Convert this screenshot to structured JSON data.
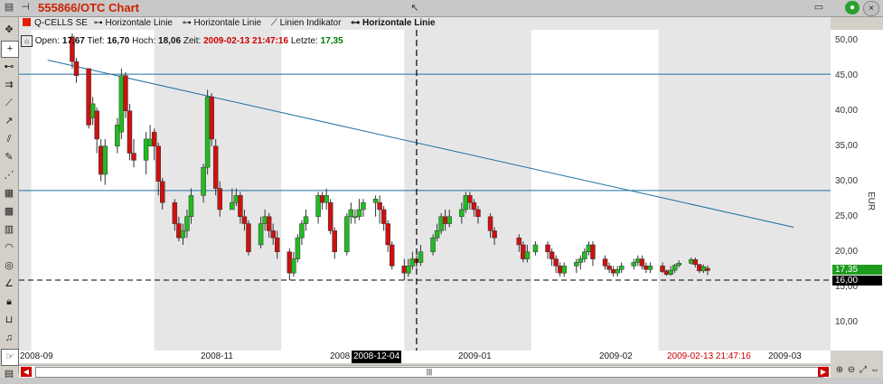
{
  "window": {
    "title": "555866/OTC Chart",
    "close_glyph": "×"
  },
  "legend": {
    "instrument": "Q-CELLS SE",
    "items": [
      "Horizontale Linie",
      "Horizontale Linie",
      "Linien Indikator",
      "Horizontale Linie"
    ]
  },
  "info": {
    "open_label": "Open:",
    "open": "17,67",
    "low_label": "Tief:",
    "low": "16,70",
    "high_label": "Hoch:",
    "high": "18,06",
    "time_label": "Zeit:",
    "time": "2009-02-13 21:47:16",
    "last_label": "Letzte:",
    "last": "17,35"
  },
  "axis": {
    "currency": "EUR",
    "ticks": [
      "50,00",
      "45,00",
      "40,00",
      "35,00",
      "30,00",
      "25,00",
      "20,00",
      "15,00",
      "10,00"
    ],
    "last_tag": "17,35",
    "cursor_tag": "16,00"
  },
  "x_labels": {
    "sep": "2008-09",
    "nov": "2008-11",
    "dec_partial": "2008",
    "cursor": "2008-12-04",
    "jan": "2009-01",
    "feb": "2009-02",
    "current": "2009-02-13 21:47:16",
    "mar": "2009-03"
  },
  "scroll": {
    "thumb": "|||"
  },
  "colors": {
    "up": "#22bb22",
    "down": "#cc1111",
    "line": "#1f6fa0",
    "title": "#cc2200"
  },
  "chart_data": {
    "type": "candlestick",
    "ylim": [
      6,
      51.5
    ],
    "horizontal_lines": [
      45.2,
      28.7,
      16.0
    ],
    "trendline": {
      "from": [
        "2008-09-05",
        47.2
      ],
      "to": [
        "2009-03-06",
        23.5
      ]
    },
    "cursor_date": "2008-12-04",
    "candles": [
      [
        "2008-09-11",
        50.5,
        47,
        51,
        46
      ],
      [
        "2008-09-12",
        47,
        45,
        47.5,
        44
      ],
      [
        "2008-09-15",
        46,
        38,
        46,
        37.5
      ],
      [
        "2008-09-16",
        39,
        41,
        42,
        38
      ],
      [
        "2008-09-17",
        40,
        36,
        40.5,
        34
      ],
      [
        "2008-09-18",
        35,
        31,
        36,
        30
      ],
      [
        "2008-09-19",
        31,
        35,
        36,
        29.5
      ],
      [
        "2008-09-22",
        35,
        38,
        39,
        34
      ],
      [
        "2008-09-23",
        37,
        45,
        46,
        36
      ],
      [
        "2008-09-24",
        45,
        40,
        45.5,
        39
      ],
      [
        "2008-09-25",
        40,
        34,
        41,
        33
      ],
      [
        "2008-09-26",
        34,
        33,
        36,
        32
      ],
      [
        "2008-09-29",
        33,
        36,
        37,
        31
      ],
      [
        "2008-09-30",
        35,
        36,
        38,
        35
      ],
      [
        "2008-10-01",
        37,
        35,
        37.5,
        33
      ],
      [
        "2008-10-02",
        35,
        30,
        35.5,
        28
      ],
      [
        "2008-10-03",
        30,
        27,
        30.5,
        26
      ],
      [
        "2008-10-06",
        27,
        24,
        27.5,
        23
      ],
      [
        "2008-10-07",
        24,
        22,
        25,
        21.5
      ],
      [
        "2008-10-08",
        22,
        23,
        24,
        21
      ],
      [
        "2008-10-09",
        23,
        25,
        26,
        22
      ],
      [
        "2008-10-10",
        25,
        28,
        29,
        24
      ],
      [
        "2008-10-13",
        28,
        32,
        32.5,
        27
      ],
      [
        "2008-10-14",
        32,
        42,
        43,
        31
      ],
      [
        "2008-10-15",
        42,
        36,
        42.5,
        35
      ],
      [
        "2008-10-16",
        35,
        29,
        36,
        28
      ],
      [
        "2008-10-17",
        29,
        26,
        30,
        25
      ],
      [
        "2008-10-20",
        26,
        27,
        29,
        26
      ],
      [
        "2008-10-21",
        27,
        28,
        29,
        26.5
      ],
      [
        "2008-10-22",
        28,
        25,
        28.5,
        24
      ],
      [
        "2008-10-23",
        25,
        24,
        26,
        23
      ],
      [
        "2008-10-24",
        24,
        20,
        24.5,
        19.5
      ],
      [
        "2008-10-27",
        21,
        24,
        25,
        20.5
      ],
      [
        "2008-10-28",
        24,
        25,
        26,
        23
      ],
      [
        "2008-10-29",
        25,
        23,
        25.5,
        22
      ],
      [
        "2008-10-30",
        23,
        22,
        24,
        21
      ],
      [
        "2008-10-31",
        22,
        20,
        23,
        19
      ],
      [
        "2008-11-03",
        20,
        17,
        20.5,
        16
      ],
      [
        "2008-11-04",
        17,
        19,
        20,
        16.5
      ],
      [
        "2008-11-05",
        19,
        22,
        22.5,
        18.5
      ],
      [
        "2008-11-06",
        22,
        24,
        24.5,
        21
      ],
      [
        "2008-11-07",
        24,
        25,
        26,
        23
      ],
      [
        "2008-11-10",
        25,
        28,
        28.5,
        24
      ],
      [
        "2008-11-11",
        28,
        27,
        28.5,
        26
      ],
      [
        "2008-11-12",
        27,
        28,
        29,
        26
      ],
      [
        "2008-11-13",
        27,
        23,
        27.5,
        22.5
      ],
      [
        "2008-11-14",
        23,
        20,
        23.5,
        19
      ],
      [
        "2008-11-17",
        20,
        25,
        25.5,
        19.5
      ],
      [
        "2008-11-18",
        25,
        26,
        27,
        24
      ],
      [
        "2008-11-19",
        25,
        25,
        26,
        24
      ],
      [
        "2008-11-20",
        25,
        26,
        27.5,
        24.5
      ],
      [
        "2008-11-21",
        26,
        27,
        27.5,
        25
      ],
      [
        "2008-11-24",
        27,
        27.5,
        28,
        25
      ],
      [
        "2008-11-25",
        27,
        26,
        28,
        24
      ],
      [
        "2008-11-26",
        26,
        24,
        26.5,
        23
      ],
      [
        "2008-11-27",
        24,
        21,
        24.5,
        20
      ],
      [
        "2008-11-28",
        21,
        18,
        21.5,
        17.5
      ],
      [
        "2008-12-01",
        18,
        17,
        19,
        16
      ],
      [
        "2008-12-02",
        17,
        18,
        19,
        16.5
      ],
      [
        "2008-12-03",
        18,
        19,
        20,
        17.5
      ],
      [
        "2008-12-04",
        19,
        18.5,
        19.5,
        17.8
      ],
      [
        "2008-12-05",
        18.5,
        20,
        21,
        18
      ],
      [
        "2008-12-08",
        20,
        22,
        22.5,
        19.5
      ],
      [
        "2008-12-09",
        22,
        23,
        24,
        21.5
      ],
      [
        "2008-12-10",
        23,
        25,
        25.5,
        22.5
      ],
      [
        "2008-12-11",
        25,
        24,
        26,
        23
      ],
      [
        "2008-12-12",
        24,
        25,
        26,
        23.5
      ],
      [
        "2008-12-15",
        25,
        26,
        27,
        24
      ],
      [
        "2008-12-16",
        26,
        28,
        28.5,
        25.5
      ],
      [
        "2008-12-17",
        28,
        27,
        28.5,
        26
      ],
      [
        "2008-12-18",
        27,
        26,
        27.5,
        25
      ],
      [
        "2008-12-19",
        26,
        25,
        26.5,
        24
      ],
      [
        "2008-12-22",
        25,
        23,
        25.5,
        22
      ],
      [
        "2008-12-23",
        23,
        22,
        23.5,
        21
      ],
      [
        "2008-12-29",
        22,
        21,
        22.5,
        20
      ],
      [
        "2008-12-30",
        21,
        19,
        21.5,
        18.5
      ],
      [
        "2008-12-31",
        19,
        20,
        21,
        18.5
      ],
      [
        "2009-01-02",
        20,
        21,
        21.5,
        19.5
      ],
      [
        "2009-01-05",
        21,
        20,
        21.5,
        19
      ],
      [
        "2009-01-06",
        20,
        19,
        20.5,
        18
      ],
      [
        "2009-01-07",
        19,
        18,
        19.5,
        17
      ],
      [
        "2009-01-08",
        18,
        17,
        18.5,
        16.5
      ],
      [
        "2009-01-09",
        17,
        18,
        18.5,
        16.5
      ],
      [
        "2009-01-12",
        18,
        18.5,
        19,
        17
      ],
      [
        "2009-01-13",
        18.5,
        19,
        19.5,
        17.5
      ],
      [
        "2009-01-14",
        19,
        20,
        20.5,
        18.5
      ],
      [
        "2009-01-15",
        20,
        21,
        21.5,
        19.5
      ],
      [
        "2009-01-16",
        21,
        19,
        21.5,
        18
      ],
      [
        "2009-01-19",
        19,
        18,
        19.5,
        17.5
      ],
      [
        "2009-01-20",
        18,
        17.5,
        18.5,
        17
      ],
      [
        "2009-01-21",
        17.5,
        17,
        18,
        16.5
      ],
      [
        "2009-01-22",
        17,
        17.5,
        18,
        16.5
      ],
      [
        "2009-01-23",
        17.5,
        18,
        18.5,
        17
      ],
      [
        "2009-01-26",
        18,
        18.5,
        19,
        17.5
      ],
      [
        "2009-01-27",
        18.5,
        19,
        19.5,
        18
      ],
      [
        "2009-01-28",
        19,
        18,
        19.5,
        17.5
      ],
      [
        "2009-01-29",
        18,
        17.5,
        18.5,
        17
      ],
      [
        "2009-01-30",
        17.5,
        18,
        18.5,
        17
      ],
      [
        "2009-02-02",
        18,
        17.2,
        18.5,
        17
      ],
      [
        "2009-02-03",
        17.3,
        16.8,
        17.5,
        16.6
      ],
      [
        "2009-02-04",
        16.8,
        17.4,
        18,
        16.6
      ],
      [
        "2009-02-05",
        17.4,
        18.1,
        18.3,
        17
      ],
      [
        "2009-02-06",
        18.1,
        18.4,
        18.8,
        17.8
      ],
      [
        "2009-02-09",
        18.4,
        18.9,
        19.2,
        18.2
      ],
      [
        "2009-02-10",
        18.9,
        18.2,
        19.2,
        17.8
      ],
      [
        "2009-02-11",
        18.2,
        17.3,
        18.3,
        17
      ],
      [
        "2009-02-12",
        17.3,
        17.9,
        18.2,
        17
      ],
      [
        "2009-02-13",
        17.67,
        17.35,
        18.06,
        16.7
      ]
    ]
  }
}
